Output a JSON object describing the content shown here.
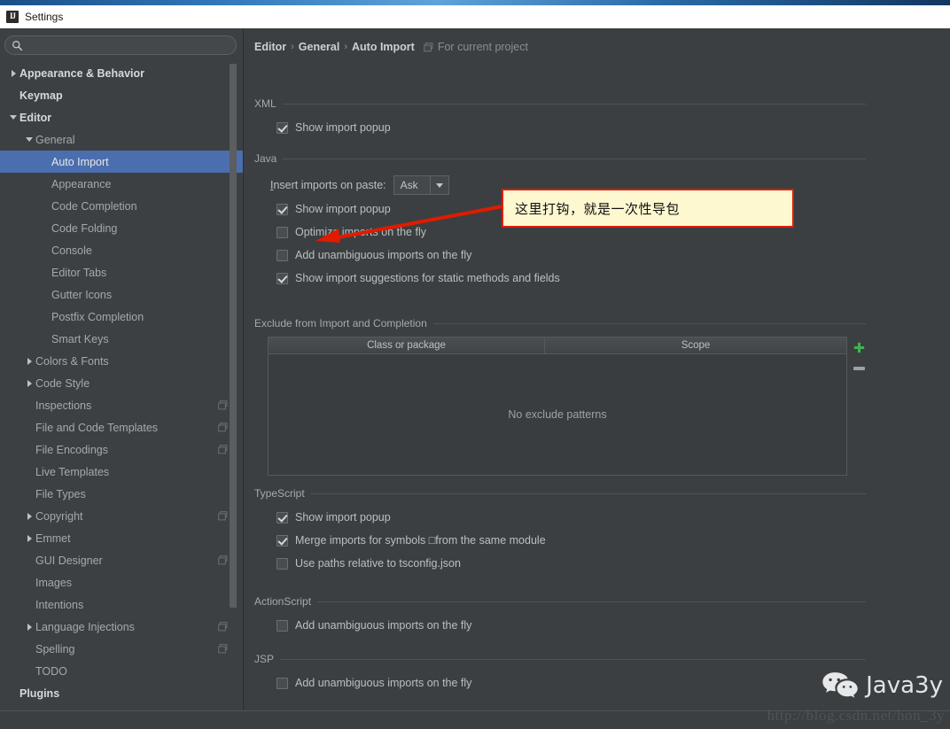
{
  "window": {
    "title": "Settings",
    "icon": "intellij-idea-icon"
  },
  "sidebar": {
    "search": {
      "value": "",
      "placeholder": "",
      "icon": "search-icon"
    },
    "items": [
      {
        "label": "Appearance & Behavior",
        "indent": 0,
        "twisty": "collapsed",
        "style": "bold",
        "project_icon": false
      },
      {
        "label": "Keymap",
        "indent": 0,
        "twisty": "none",
        "style": "bold",
        "project_icon": false
      },
      {
        "label": "Editor",
        "indent": 0,
        "twisty": "expanded",
        "style": "bold",
        "project_icon": false
      },
      {
        "label": "General",
        "indent": 1,
        "twisty": "expanded",
        "style": "dim",
        "project_icon": false
      },
      {
        "label": "Auto Import",
        "indent": 2,
        "twisty": "none",
        "style": "selected",
        "project_icon": false
      },
      {
        "label": "Appearance",
        "indent": 2,
        "twisty": "none",
        "style": "dim",
        "project_icon": false
      },
      {
        "label": "Code Completion",
        "indent": 2,
        "twisty": "none",
        "style": "dim",
        "project_icon": false
      },
      {
        "label": "Code Folding",
        "indent": 2,
        "twisty": "none",
        "style": "dim",
        "project_icon": false
      },
      {
        "label": "Console",
        "indent": 2,
        "twisty": "none",
        "style": "dim",
        "project_icon": false
      },
      {
        "label": "Editor Tabs",
        "indent": 2,
        "twisty": "none",
        "style": "dim",
        "project_icon": false
      },
      {
        "label": "Gutter Icons",
        "indent": 2,
        "twisty": "none",
        "style": "dim",
        "project_icon": false
      },
      {
        "label": "Postfix Completion",
        "indent": 2,
        "twisty": "none",
        "style": "dim",
        "project_icon": false
      },
      {
        "label": "Smart Keys",
        "indent": 2,
        "twisty": "none",
        "style": "dim",
        "project_icon": false
      },
      {
        "label": "Colors & Fonts",
        "indent": 1,
        "twisty": "collapsed",
        "style": "dim",
        "project_icon": false
      },
      {
        "label": "Code Style",
        "indent": 1,
        "twisty": "collapsed",
        "style": "dim",
        "project_icon": false
      },
      {
        "label": "Inspections",
        "indent": 1,
        "twisty": "none",
        "style": "dim",
        "project_icon": true
      },
      {
        "label": "File and Code Templates",
        "indent": 1,
        "twisty": "none",
        "style": "dim",
        "project_icon": true
      },
      {
        "label": "File Encodings",
        "indent": 1,
        "twisty": "none",
        "style": "dim",
        "project_icon": true
      },
      {
        "label": "Live Templates",
        "indent": 1,
        "twisty": "none",
        "style": "dim",
        "project_icon": false
      },
      {
        "label": "File Types",
        "indent": 1,
        "twisty": "none",
        "style": "dim",
        "project_icon": false
      },
      {
        "label": "Copyright",
        "indent": 1,
        "twisty": "collapsed",
        "style": "dim",
        "project_icon": true
      },
      {
        "label": "Emmet",
        "indent": 1,
        "twisty": "collapsed",
        "style": "dim",
        "project_icon": false
      },
      {
        "label": "GUI Designer",
        "indent": 1,
        "twisty": "none",
        "style": "dim",
        "project_icon": true
      },
      {
        "label": "Images",
        "indent": 1,
        "twisty": "none",
        "style": "dim",
        "project_icon": false
      },
      {
        "label": "Intentions",
        "indent": 1,
        "twisty": "none",
        "style": "dim",
        "project_icon": false
      },
      {
        "label": "Language Injections",
        "indent": 1,
        "twisty": "collapsed",
        "style": "dim",
        "project_icon": true
      },
      {
        "label": "Spelling",
        "indent": 1,
        "twisty": "none",
        "style": "dim",
        "project_icon": true
      },
      {
        "label": "TODO",
        "indent": 1,
        "twisty": "none",
        "style": "dim",
        "project_icon": false
      },
      {
        "label": "Plugins",
        "indent": 0,
        "twisty": "none",
        "style": "bold",
        "project_icon": false
      }
    ]
  },
  "content": {
    "breadcrumb": {
      "crumbs": [
        "Editor",
        "General",
        "Auto Import"
      ],
      "separator": "›",
      "project_scope_label": "For current project",
      "project_scope_icon": "project-scope-icon"
    },
    "groups": [
      {
        "title": "XML",
        "checkboxes": [
          {
            "label": "Show import popup",
            "checked": true
          }
        ]
      },
      {
        "title": "Java",
        "field": {
          "label_prefix": "I",
          "label_rest": "nsert imports on paste:",
          "combo_value": "Ask",
          "combo_icon": "chevron-down-icon"
        },
        "checkboxes": [
          {
            "label": "Show import popup",
            "checked": true
          },
          {
            "label": "Optimize imports on the fly",
            "checked": false
          },
          {
            "label": "Add unambiguous imports on the fly",
            "checked": false
          },
          {
            "label": "Show import suggestions for static methods and fields",
            "checked": true
          }
        ]
      },
      {
        "title": "Exclude from Import and Completion",
        "checkboxes": []
      },
      {
        "title": "TypeScript",
        "checkboxes": [
          {
            "label": "Show import popup",
            "checked": true
          },
          {
            "label": "Merge imports for symbols □from the same module",
            "checked": true
          },
          {
            "label": "Use paths relative to tsconfig.json",
            "checked": false
          }
        ]
      },
      {
        "title": "ActionScript",
        "checkboxes": [
          {
            "label": "Add unambiguous imports on the fly",
            "checked": false
          }
        ]
      },
      {
        "title": "JSP",
        "checkboxes": [
          {
            "label": "Add unambiguous imports on the fly",
            "checked": false
          }
        ]
      }
    ],
    "exclude_table": {
      "columns": [
        "Class or package",
        "Scope"
      ],
      "rows": [],
      "empty_text": "No exclude patterns",
      "add_button": {
        "label": "+",
        "icon": "plus-icon"
      },
      "remove_button": {
        "label": "−",
        "icon": "minus-icon"
      }
    }
  },
  "annotation": {
    "callout_text": "这里打钩，就是一次性导包",
    "callout_bg": "#FDF8D0",
    "callout_border": "#E01B00",
    "arrow_color": "#E01B00",
    "arrow_icon": "arrow-pointer-icon"
  },
  "watermark": {
    "name": "Java3y",
    "icon": "wechat-icon",
    "url": "http://blog.csdn.net/hon_3y"
  },
  "colors": {
    "window_bg": "#3C3F41",
    "sidebar_bg": "#3C4043",
    "selection": "#4B6EAF",
    "text": "#BCBFC0",
    "accent_green": "#3FB34F"
  }
}
